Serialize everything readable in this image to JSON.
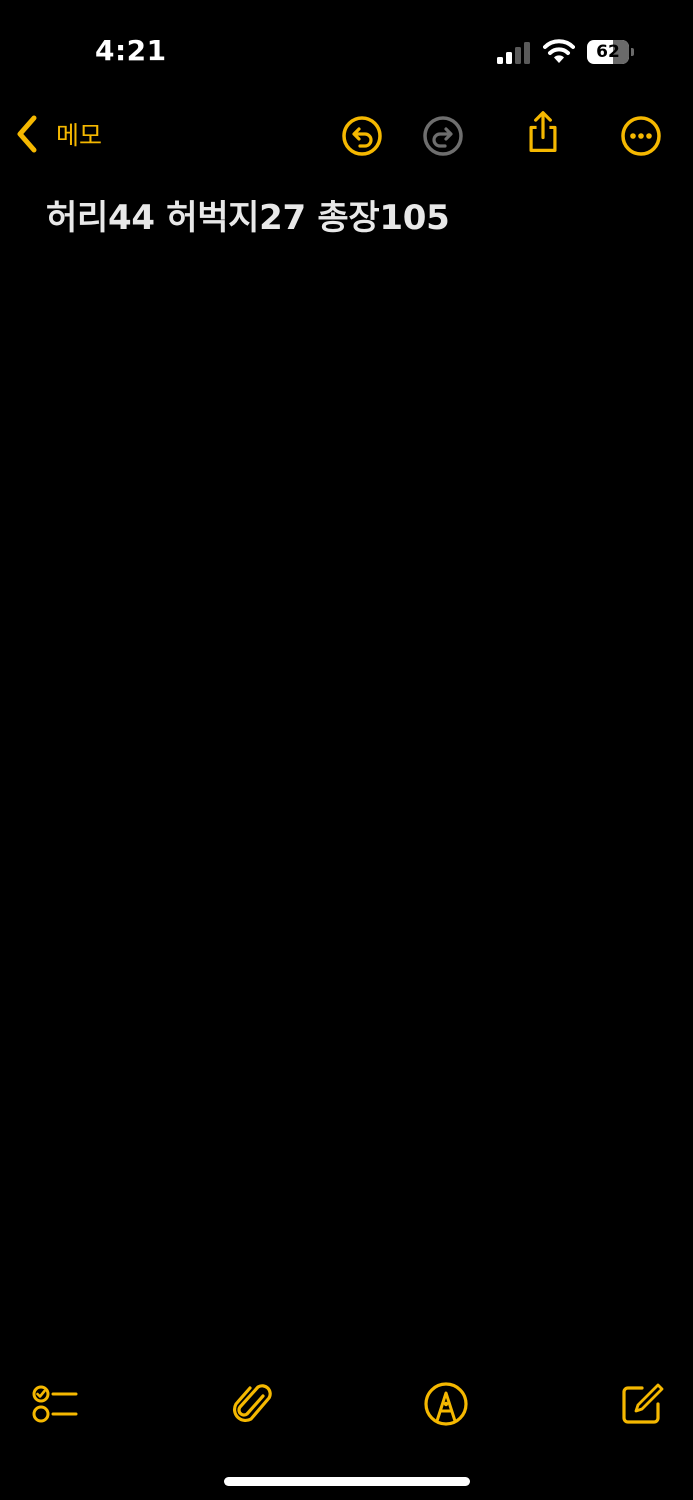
{
  "status_bar": {
    "time": "4:21",
    "battery_percent": 62,
    "battery_label": "62"
  },
  "nav": {
    "back_label": "메모",
    "icons": [
      "chevron-left-icon",
      "undo-icon",
      "redo-icon",
      "share-icon",
      "more-icon"
    ]
  },
  "note": {
    "text": "허리44 허벅지27 총장105"
  },
  "toolbar": {
    "icons": [
      "checklist-icon",
      "paperclip-icon",
      "markup-pen-icon",
      "compose-icon"
    ]
  },
  "colors": {
    "accent": "#f5b800",
    "background": "#000000",
    "text": "#e8e8e8",
    "disabled": "#7a7a7a"
  }
}
